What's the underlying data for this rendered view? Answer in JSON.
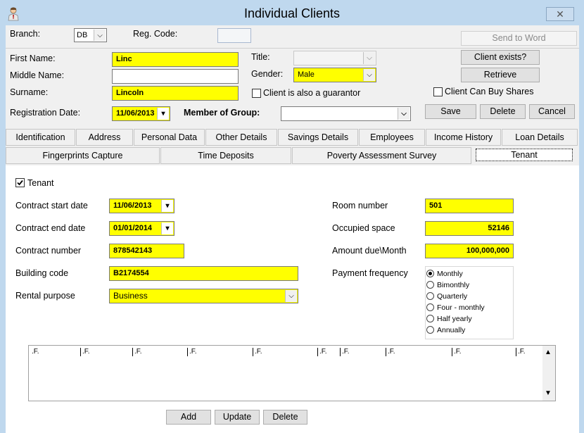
{
  "window": {
    "title": "Individual Clients",
    "close_glyph": "✕"
  },
  "header": {
    "branch_label": "Branch:",
    "branch_value": "DB",
    "reg_code_label": "Reg. Code:",
    "reg_code_value": "",
    "send_to_word": "Send to Word"
  },
  "person": {
    "first_name_label": "First Name:",
    "first_name": "Linc",
    "middle_name_label": "Middle Name:",
    "middle_name": "",
    "surname_label": "Surname:",
    "surname": "Lincoln",
    "reg_date_label": "Registration Date:",
    "reg_date": "11/06/2013",
    "title_label": "Title:",
    "title_value": "",
    "gender_label": "Gender:",
    "gender": "Male",
    "guarantor_label": "Client is also a guarantor",
    "group_label": "Member of Group:",
    "group_value": ""
  },
  "actions": {
    "client_exists": "Client exists?",
    "retrieve": "Retrieve",
    "buy_shares_label": "Client Can Buy Shares",
    "save": "Save",
    "delete": "Delete",
    "cancel": "Cancel"
  },
  "tabs_row1": [
    "Identification",
    "Address",
    "Personal Data",
    "Other Details",
    "Savings Details",
    "Employees",
    "Income History",
    "Loan Details"
  ],
  "tabs_row2": [
    "Fingerprints Capture",
    "Time Deposits",
    "Poverty Assessment Survey",
    "Tenant"
  ],
  "tenant": {
    "tenant_label": "Tenant",
    "contract_start_label": "Contract start date",
    "contract_start": "11/06/2013",
    "contract_end_label": "Contract end date",
    "contract_end": "01/01/2014",
    "contract_number_label": "Contract number",
    "contract_number": "878542143",
    "building_code_label": "Building code",
    "building_code": "B2174554",
    "rental_purpose_label": "Rental purpose",
    "rental_purpose": "Business",
    "room_number_label": "Room number",
    "room_number": "501",
    "occupied_space_label": "Occupied space",
    "occupied_space": "52146",
    "amount_due_label": "Amount due\\Month",
    "amount_due": "100,000,000",
    "payment_frequency_label": "Payment frequency",
    "payment_options": [
      "Monthly",
      "Bimonthly",
      "Quarterly",
      "Four - monthly",
      "Half yearly",
      "Annually"
    ],
    "payment_selected": "Monthly"
  },
  "grid": {
    "columns": [
      ".F.",
      ".F.",
      ".F.",
      ".F.",
      ".F.",
      ".F.",
      ".F.",
      ".F.",
      ".F.",
      ".F."
    ]
  },
  "grid_buttons": {
    "add": "Add",
    "update": "Update",
    "delete": "Delete"
  }
}
